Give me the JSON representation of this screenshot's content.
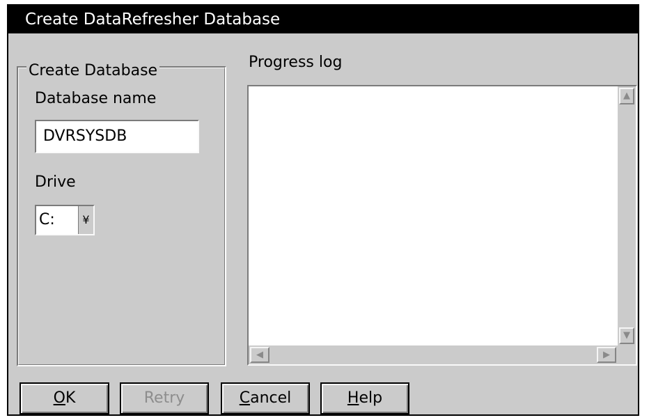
{
  "window": {
    "title": "Create DataRefresher Database"
  },
  "create_group": {
    "legend": "Create Database",
    "db_name_label": "Database name",
    "db_name_value": "DVRSYSDB",
    "drive_label": "Drive",
    "drive_value": "C:",
    "drive_dropdown_glyph": "¥"
  },
  "progress": {
    "label": "Progress log",
    "log_text": ""
  },
  "buttons": {
    "ok": {
      "mnemonic": "O",
      "rest": "K"
    },
    "retry": {
      "label": "Retry"
    },
    "cancel": {
      "mnemonic": "C",
      "rest": "ancel"
    },
    "help": {
      "mnemonic": "H",
      "rest": "elp"
    }
  }
}
